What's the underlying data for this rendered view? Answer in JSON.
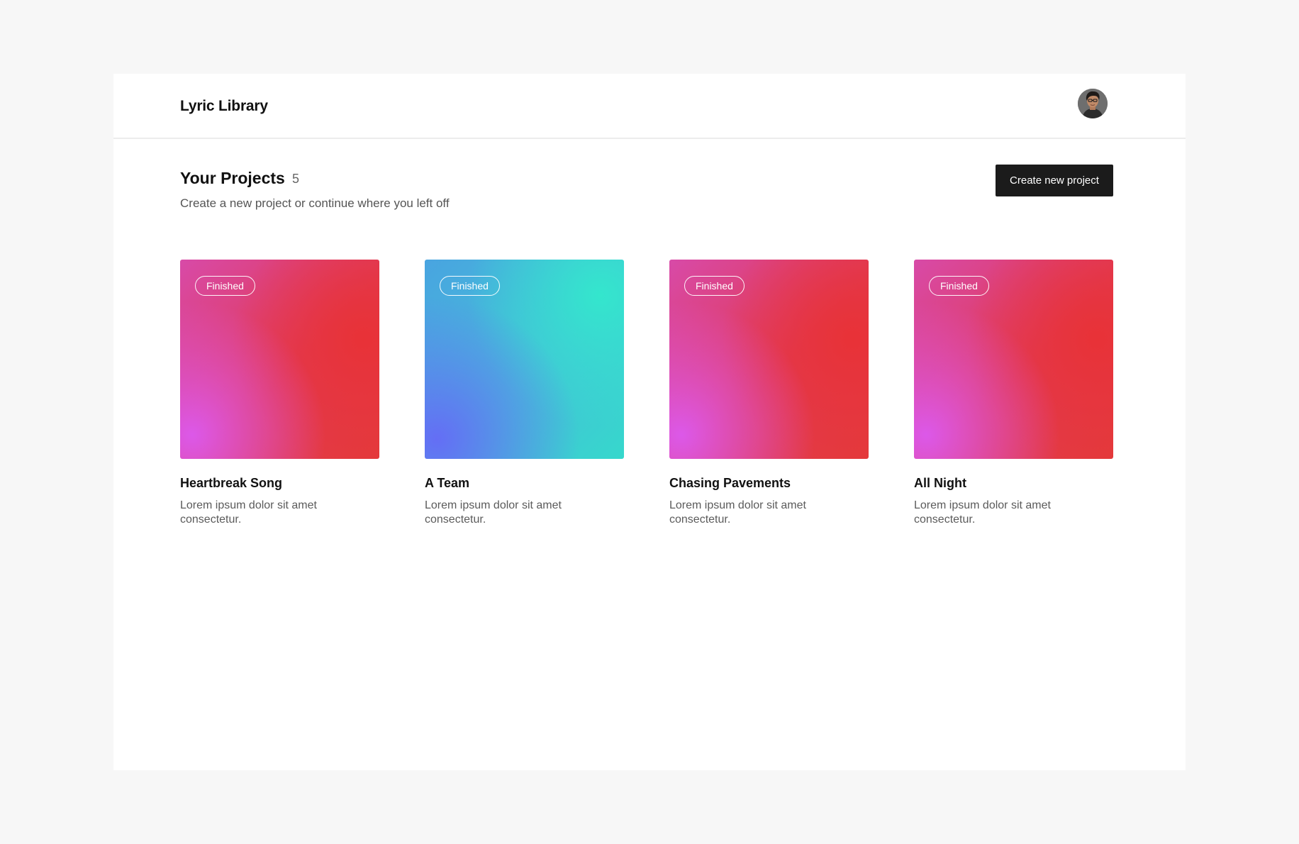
{
  "app": {
    "title": "Lyric Library",
    "avatar_alt": "User avatar"
  },
  "projects": {
    "title": "Your Projects",
    "count": "5",
    "subtitle": "Create a new project or continue where you left off",
    "create_label": "Create new project"
  },
  "cards": [
    {
      "title": "Heartbreak Song",
      "status": "Finished",
      "description": "Lorem ipsum dolor sit amet consectetur.",
      "cover": "pink-red-gradient"
    },
    {
      "title": "A Team",
      "status": "Finished",
      "description": "Lorem ipsum dolor sit amet consectetur.",
      "cover": "blue-teal-gradient"
    },
    {
      "title": "Chasing Pavements",
      "status": "Finished",
      "description": "Lorem ipsum dolor sit amet consectetur.",
      "cover": "pink-red-gradient"
    },
    {
      "title": "All Night",
      "status": "Finished",
      "description": "Lorem ipsum dolor sit amet consectetur.",
      "cover": "pink-red-gradient"
    }
  ],
  "colors": {
    "page_background": "#f7f7f7",
    "surface": "#ffffff",
    "button": "#1b1b1b",
    "gradient_pink": "#d95ae8",
    "gradient_red": "#e43a3a",
    "gradient_blue": "#5f75ef",
    "gradient_teal": "#36e2cf"
  }
}
